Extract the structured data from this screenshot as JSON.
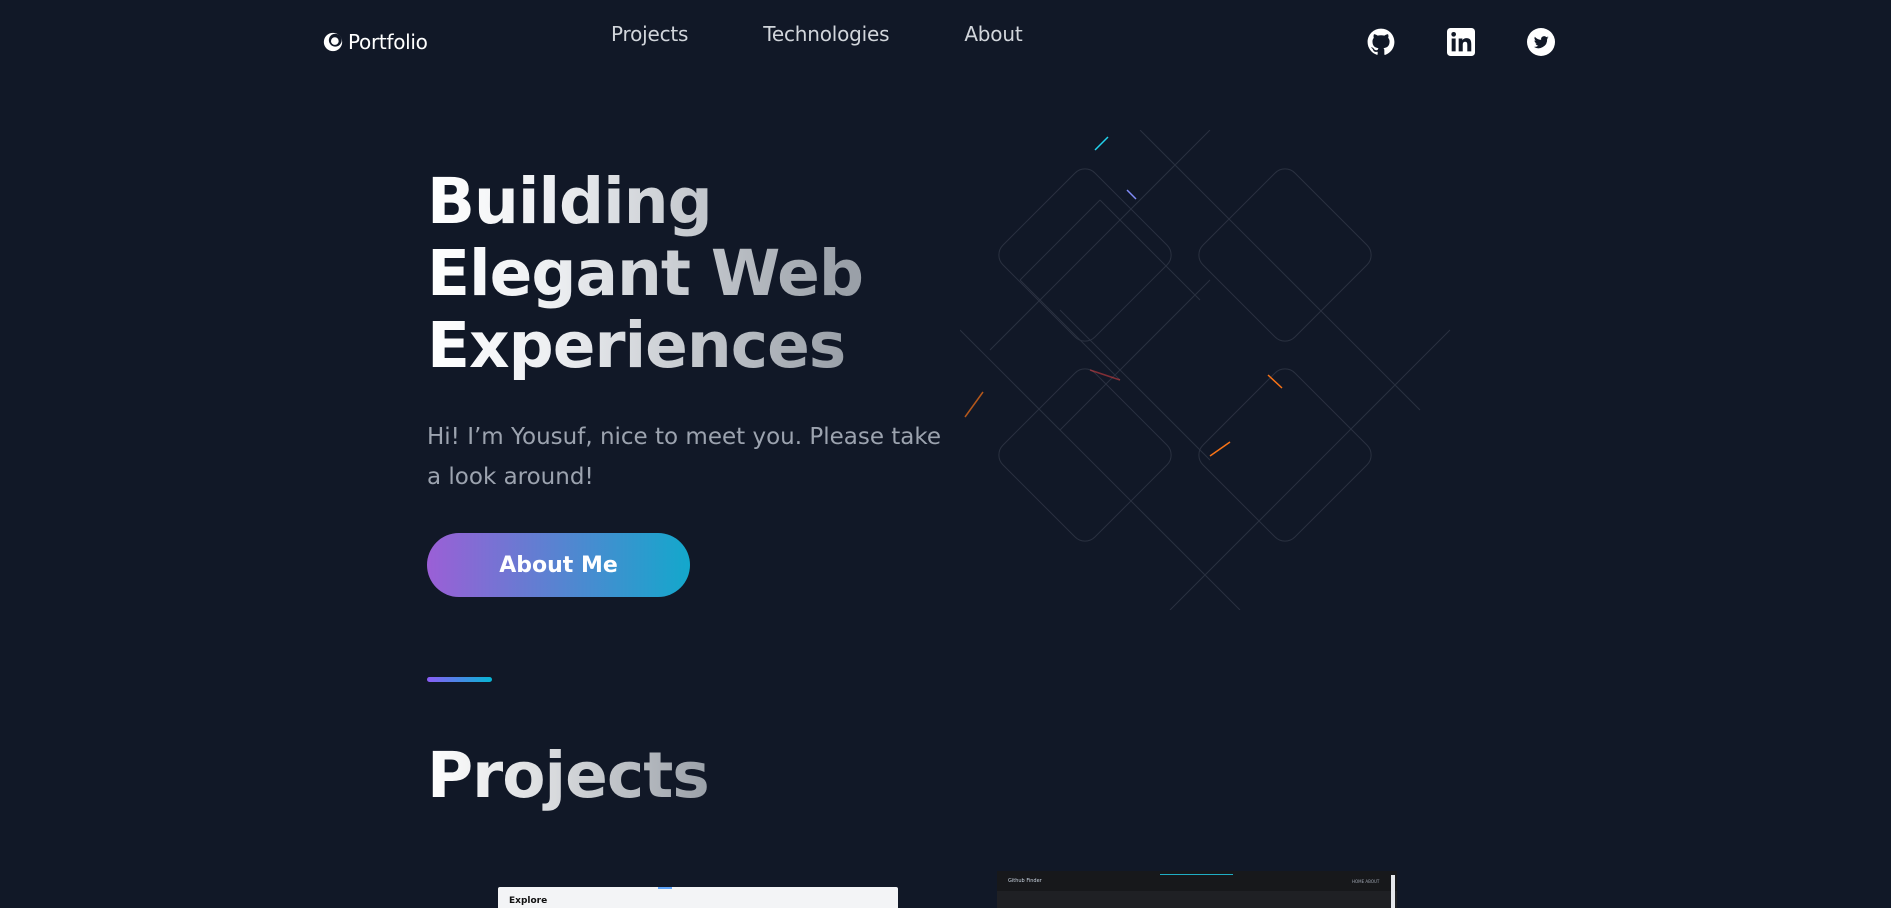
{
  "header": {
    "logo_text": "Portfolio",
    "nav": [
      {
        "label": "Projects"
      },
      {
        "label": "Technologies"
      },
      {
        "label": "About"
      }
    ],
    "social": [
      {
        "icon": "github-icon"
      },
      {
        "icon": "linkedin-icon"
      },
      {
        "icon": "twitter-icon"
      }
    ]
  },
  "hero": {
    "title_lines": [
      "Building",
      "Elegant Web",
      "Experiences"
    ],
    "subtitle": "Hi! I’m Yousuf, nice to meet you. Please take a look around!",
    "cta_label": "About Me"
  },
  "projects": {
    "title": "Projects",
    "cards": [
      {
        "heading": "Explore"
      },
      {
        "logo": "Github Finder",
        "nav": "HOME ABOUT"
      }
    ]
  },
  "colors": {
    "background": "#111827",
    "gradient_start": "#9b5fd6",
    "gradient_end": "#13a8cc",
    "nav_text": "#d1d5db",
    "subtitle_text": "#9ca3af"
  }
}
